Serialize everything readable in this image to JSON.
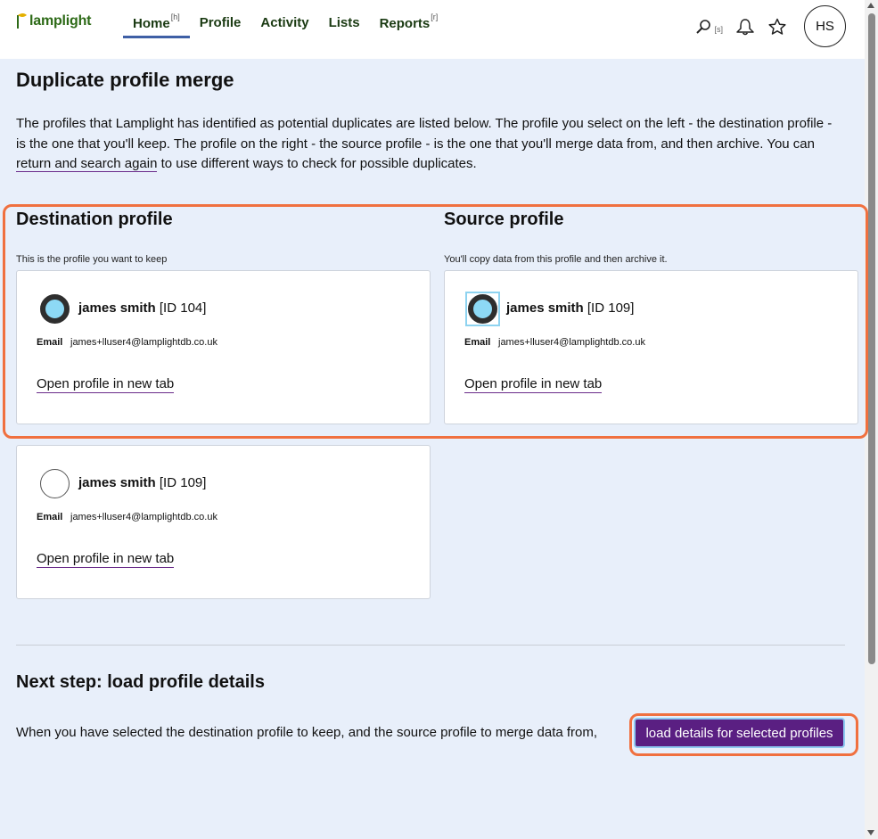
{
  "brand": {
    "logo_text": "lamplight"
  },
  "nav": {
    "items": [
      {
        "label": "Home",
        "shortcut": "[h]",
        "active": true
      },
      {
        "label": "Profile",
        "shortcut": "",
        "active": false
      },
      {
        "label": "Activity",
        "shortcut": "",
        "active": false
      },
      {
        "label": "Lists",
        "shortcut": "",
        "active": false
      },
      {
        "label": "Reports",
        "shortcut": "[r]",
        "active": false
      }
    ],
    "search_shortcut": "[s]",
    "user_initials": "HS"
  },
  "page": {
    "title": "Duplicate profile merge",
    "intro_before_link": "The profiles that Lamplight has identified as potential duplicates are listed below. The profile you select on the left - the destination profile - is the one that you'll keep. The profile on the right - the source profile - is the one that you'll merge data from, and then archive. You can ",
    "intro_link": "return and search again",
    "intro_after_link": " to use different ways to check for possible duplicates."
  },
  "destination": {
    "title": "Destination profile",
    "hint": "This is the profile you want to keep",
    "cards": [
      {
        "name": "james smith",
        "id": "[ID 104]",
        "email_label": "Email",
        "email": "james+lluser4@lamplightdb.co.uk",
        "link": "Open profile in new tab",
        "selected": true
      },
      {
        "name": "james smith",
        "id": "[ID 109]",
        "email_label": "Email",
        "email": "james+lluser4@lamplightdb.co.uk",
        "link": "Open profile in new tab",
        "selected": false
      }
    ]
  },
  "source": {
    "title": "Source profile",
    "hint": "You'll copy data from this profile and then archive it.",
    "cards": [
      {
        "name": "james smith",
        "id": "[ID 109]",
        "email_label": "Email",
        "email": "james+lluser4@lamplightdb.co.uk",
        "link": "Open profile in new tab",
        "selected": true
      }
    ]
  },
  "next_step": {
    "title": "Next step: load profile details",
    "text": "When you have selected the destination profile to keep, and the source profile to merge data from,",
    "button": "load details for selected profiles"
  },
  "colors": {
    "background": "#e8effa",
    "brand_green": "#2d6a17",
    "primary_purple": "#5a1f82",
    "highlight_orange": "#f0703f",
    "radio_fill": "#8dd9f5"
  }
}
